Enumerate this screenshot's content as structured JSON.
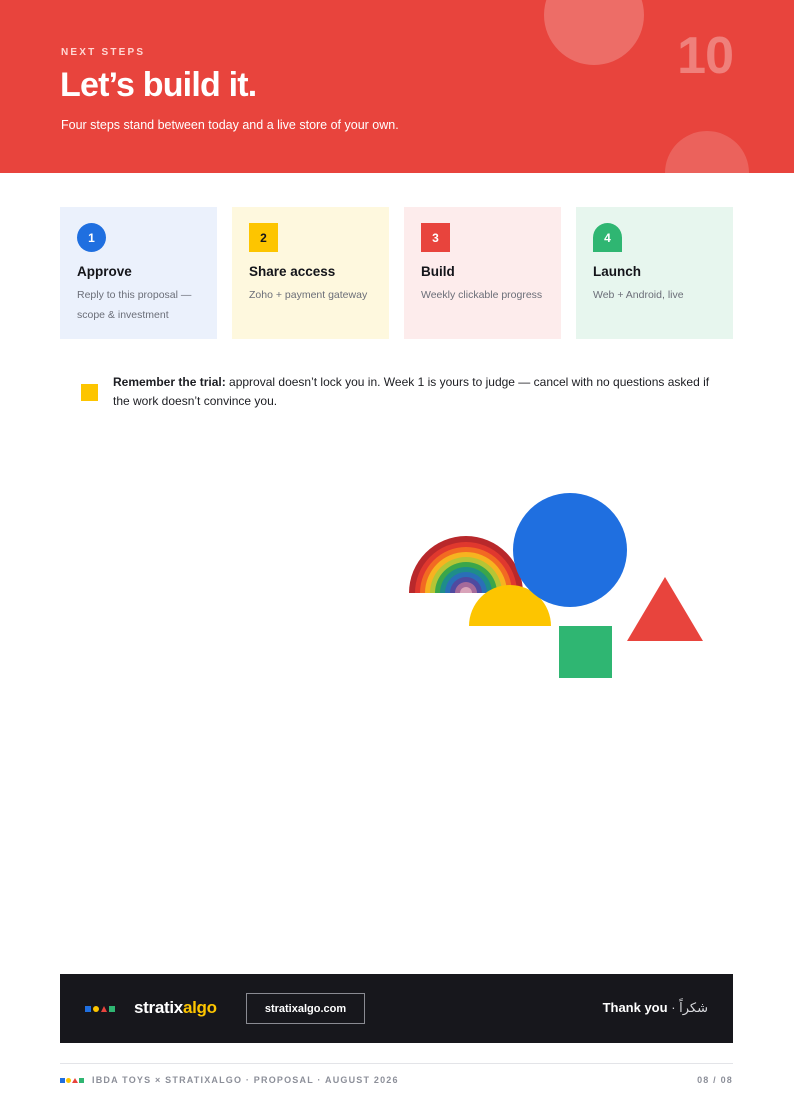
{
  "header": {
    "kicker": "NEXT STEPS",
    "title": "Let’s build it.",
    "subtitle": "Four steps stand between today and a live store of your own.",
    "page_number": "10"
  },
  "steps": [
    {
      "number": "1",
      "title": "Approve",
      "description": "Reply to this proposal — scope & investment",
      "color": "#1f6fe0",
      "bg": "#ebf1fc",
      "shape": "circle"
    },
    {
      "number": "2",
      "title": "Share access",
      "description": "Zoho + payment gateway",
      "color": "#fdc500",
      "bg": "#fef8de",
      "shape": "square"
    },
    {
      "number": "3",
      "title": "Build",
      "description": "Weekly clickable progress",
      "color": "#e8443d",
      "bg": "#fdecec",
      "shape": "square"
    },
    {
      "number": "4",
      "title": "Launch",
      "description": "Web + Android, live",
      "color": "#2fb672",
      "bg": "#e7f6ee",
      "shape": "arch"
    }
  ],
  "note": {
    "lead": "Remember the trial:",
    "body": " approval doesn’t lock you in. Week 1 is yours to judge — cancel with no questions asked if the work doesn’t convince you."
  },
  "footer": {
    "brand_prefix": "stratix",
    "brand_suffix": "algo",
    "url": "stratixalgo.com",
    "thanks": "Thank you",
    "thanks_separator": " · ",
    "thanks_arabic": "شكراً",
    "meta": "IBDA TOYS × STRATIXALGO · PROPOSAL · AUGUST 2026",
    "pager": "08 / 08"
  },
  "colors": {
    "red": "#e8443d",
    "blue": "#1f6fe0",
    "yellow": "#fdc500",
    "green": "#2fb672",
    "dark": "#17171c"
  }
}
